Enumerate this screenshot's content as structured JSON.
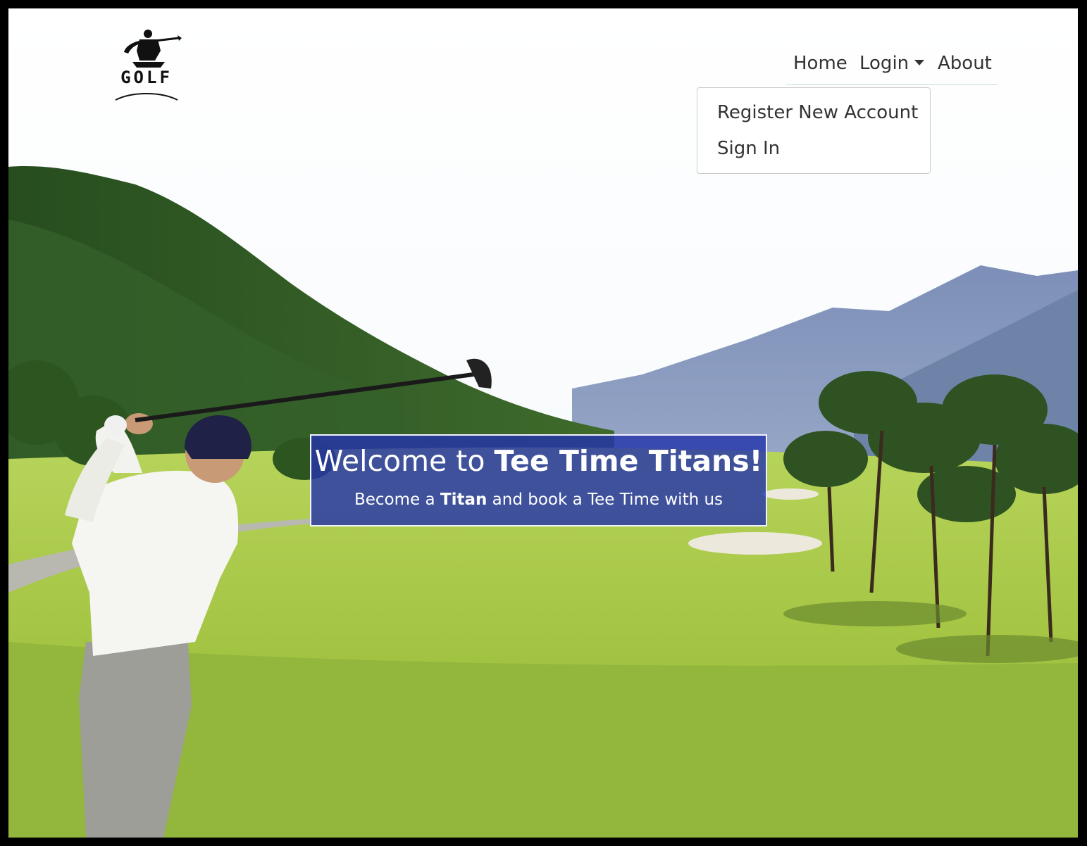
{
  "logo": {
    "text": "GOLF",
    "icon": "golfer-silhouette-icon"
  },
  "nav": {
    "home": "Home",
    "login": "Login",
    "about": "About",
    "login_dropdown": {
      "register": "Register New Account",
      "sign_in": "Sign In"
    }
  },
  "hero": {
    "title_prefix": "Welcome to ",
    "title_brand": "Tee Time Titans!",
    "subtitle_prefix": "Become a ",
    "subtitle_brand": "Titan",
    "subtitle_suffix": " and book a Tee Time with us"
  },
  "colors": {
    "banner": "#2434aa",
    "fairway": "#a8c84a",
    "text": "#333333"
  }
}
